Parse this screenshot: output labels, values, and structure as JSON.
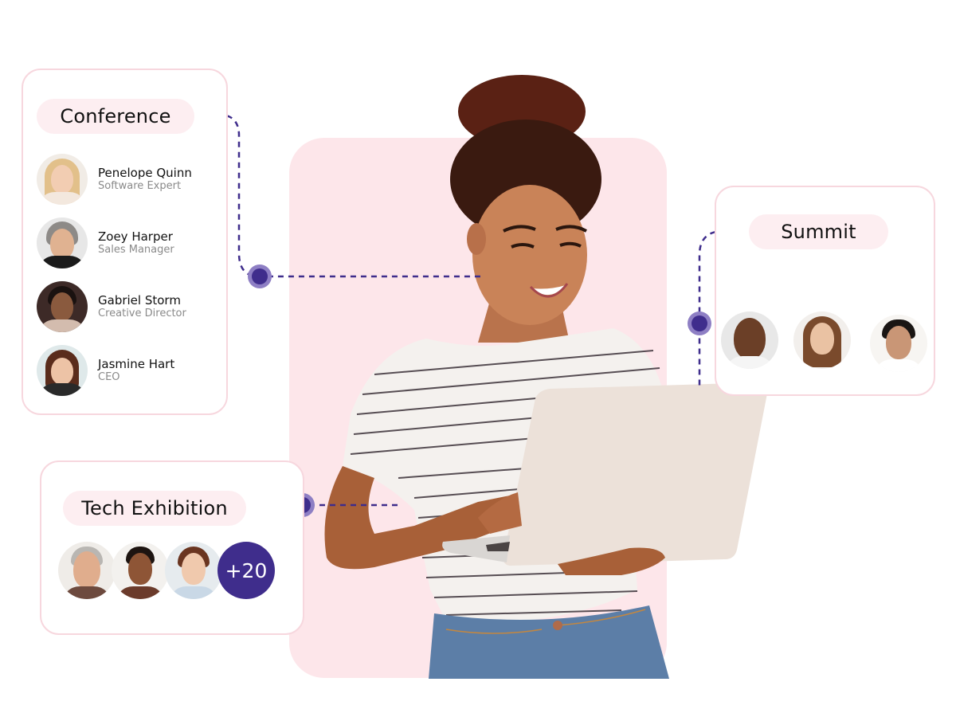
{
  "colors": {
    "accent": "#3f2d8c",
    "accent_halo": "#8e7fc4",
    "panel_pink": "#fde6ea",
    "pill_pink": "#fdeef1",
    "card_border": "#f7d7de",
    "text_primary": "#111111",
    "text_secondary": "#8a8a8a"
  },
  "conference": {
    "title": "Conference",
    "people": [
      {
        "name": "Penelope Quinn",
        "role": "Software Expert",
        "avatar": "avatar-photo-blonde-woman"
      },
      {
        "name": "Zoey Harper",
        "role": "Sales Manager",
        "avatar": "avatar-photo-gray-haired-woman"
      },
      {
        "name": "Gabriel Storm",
        "role": "Creative Director",
        "avatar": "avatar-photo-man-glasses"
      },
      {
        "name": "Jasmine Hart",
        "role": "CEO",
        "avatar": "avatar-photo-brunette-woman"
      }
    ]
  },
  "summit": {
    "title": "Summit",
    "attendees": [
      {
        "avatar": "avatar-photo-bald-man"
      },
      {
        "avatar": "avatar-photo-long-haired-woman"
      },
      {
        "avatar": "avatar-photo-dark-haired-man"
      }
    ]
  },
  "tech_exhibition": {
    "title": "Tech Exhibition",
    "attendees": [
      {
        "avatar": "avatar-photo-gray-haired-man"
      },
      {
        "avatar": "avatar-photo-short-haired-woman"
      },
      {
        "avatar": "avatar-photo-ponytail-woman"
      }
    ],
    "more_count": "+20"
  },
  "hero": {
    "image": "woman-with-laptop-photo"
  }
}
